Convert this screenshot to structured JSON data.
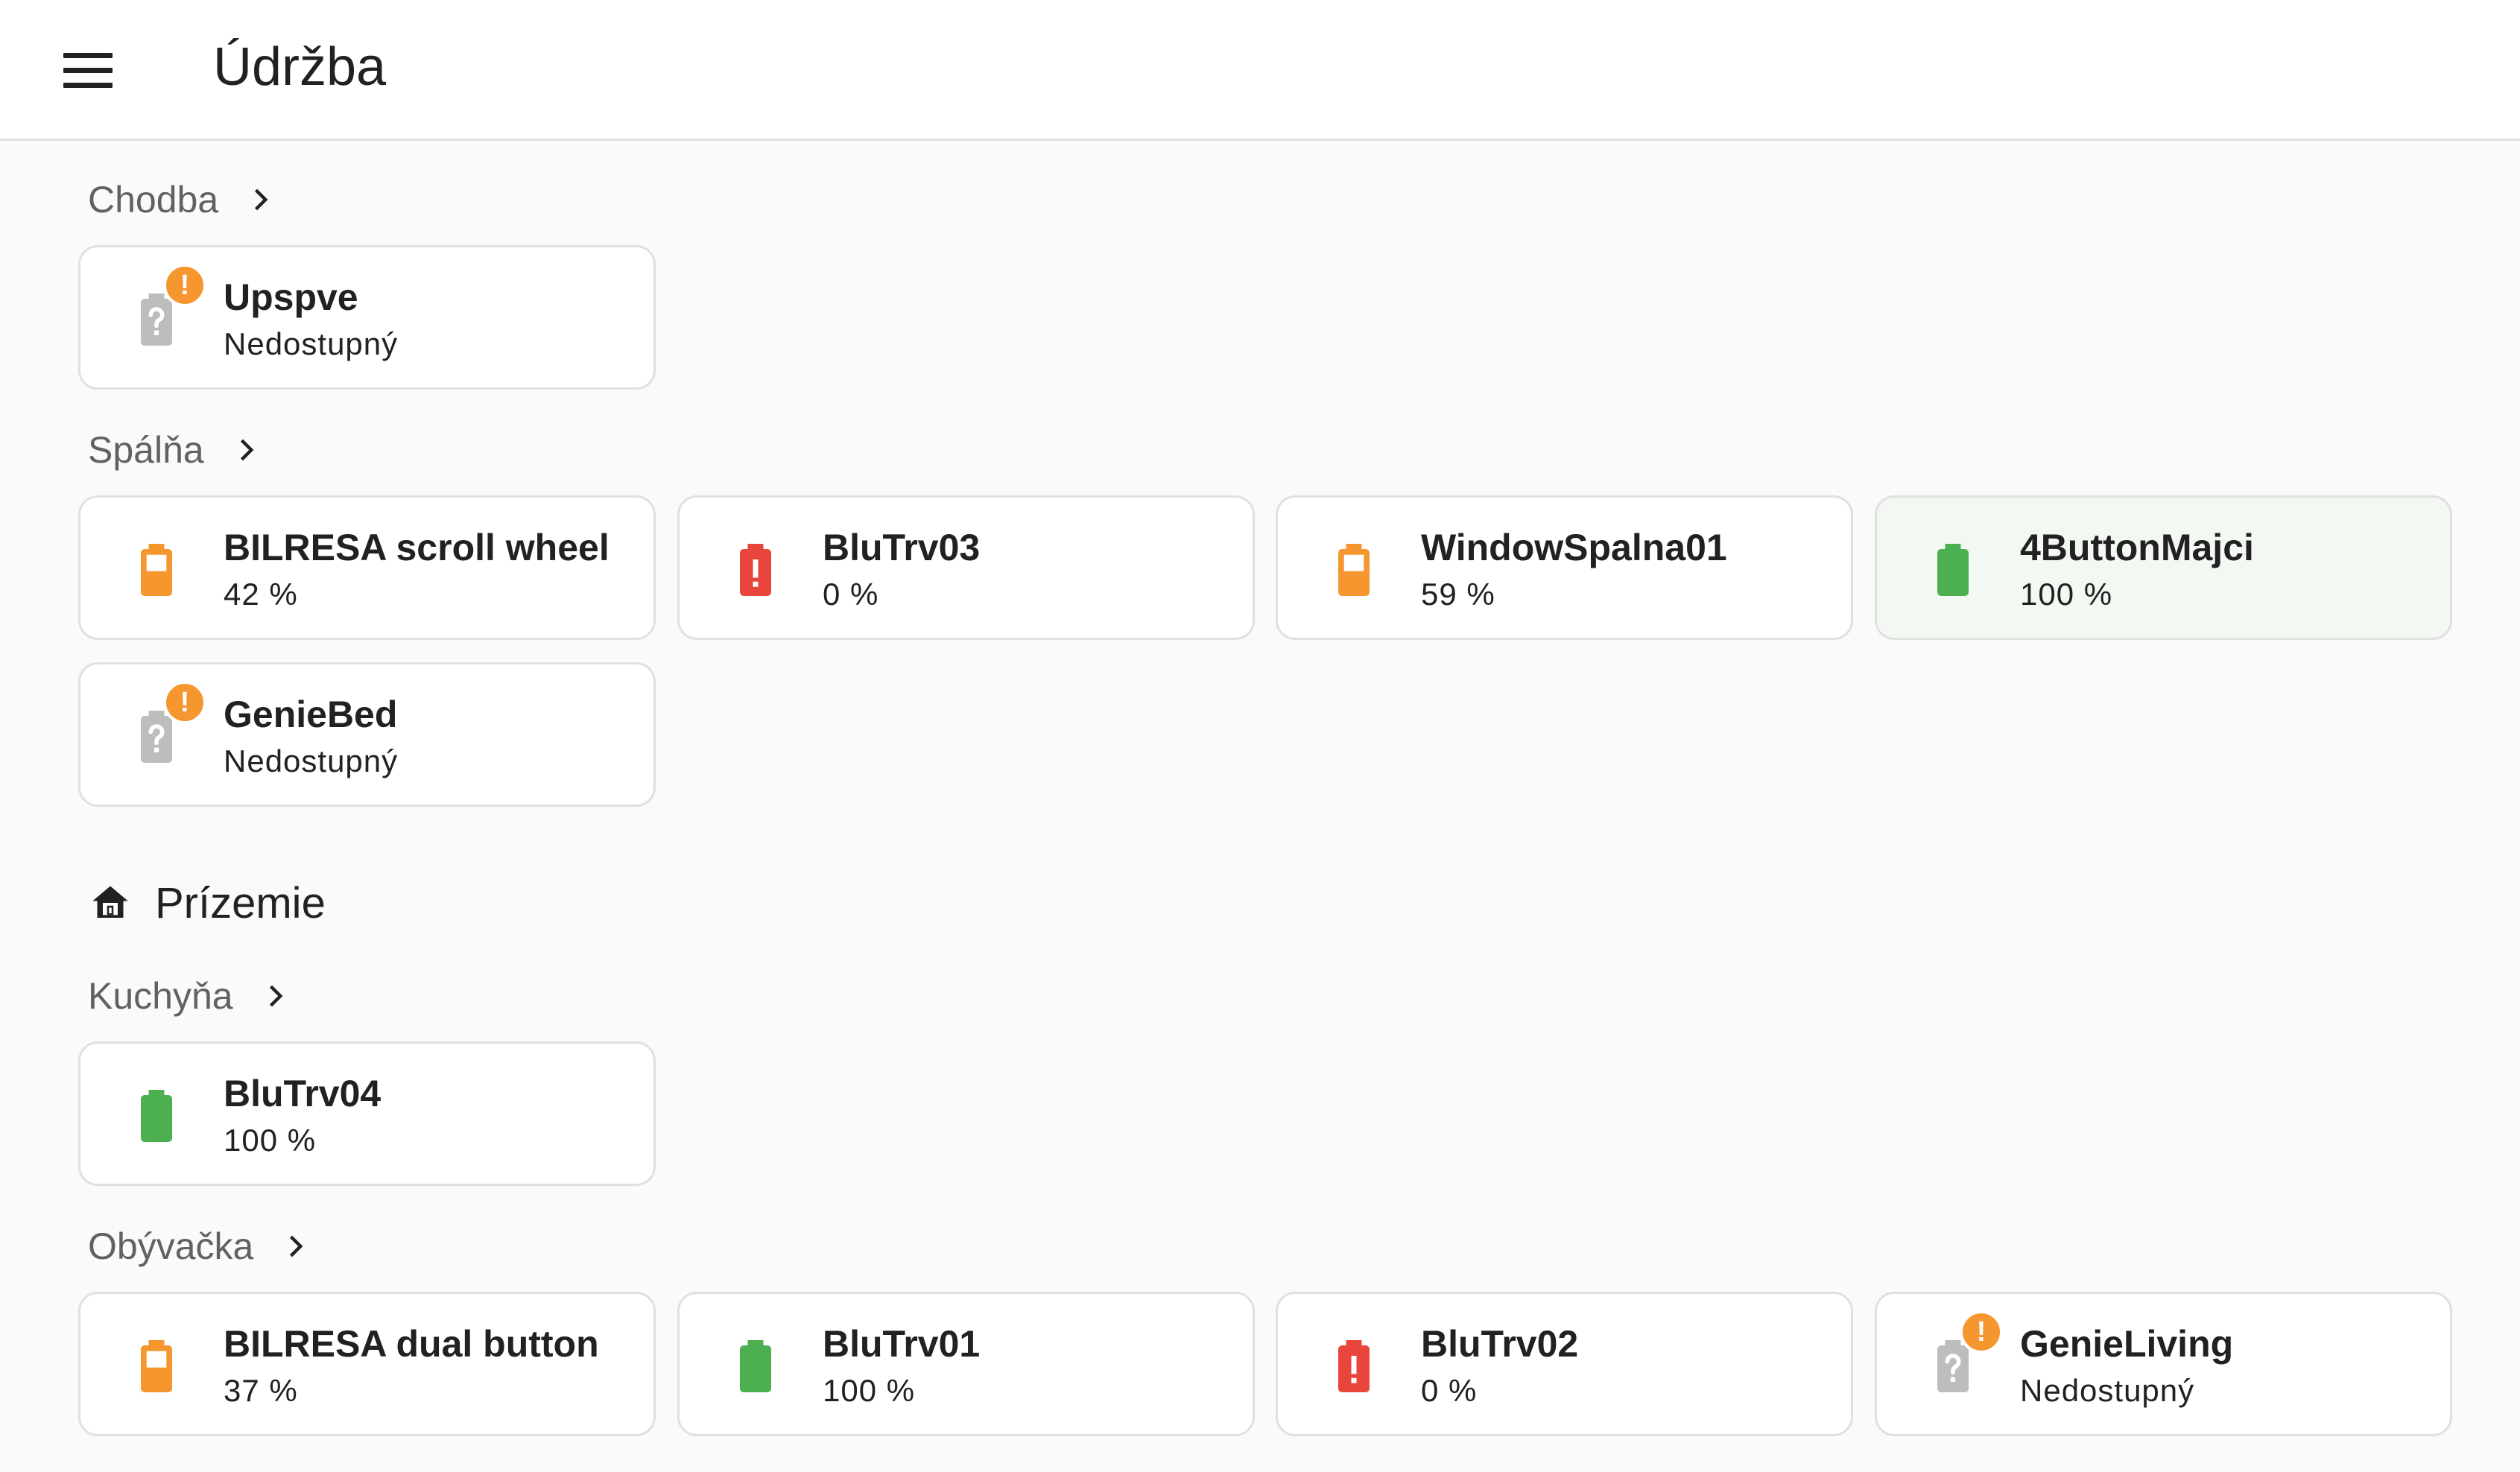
{
  "header": {
    "title": "Údržba"
  },
  "colors": {
    "orange": "#f5962e",
    "red": "#e8453c",
    "green": "#4caf50",
    "unknown": "#bdbdbd"
  },
  "areas": {
    "chodba": {
      "name": "Chodba",
      "devices": [
        {
          "name": "Upspve",
          "state": "Nedostupný",
          "battery_icon": "battery-unknown-icon",
          "warning": true
        }
      ]
    },
    "spalna": {
      "name": "Spálňa",
      "devices": [
        {
          "name": "BILRESA scroll wheel",
          "state": "42 %",
          "battery_icon": "battery-medium-icon",
          "level": 42
        },
        {
          "name": "BluTrv03",
          "state": "0 %",
          "battery_icon": "battery-alert-icon",
          "level": 0
        },
        {
          "name": "WindowSpalna01",
          "state": "59 %",
          "battery_icon": "battery-medium-icon",
          "level": 59
        },
        {
          "name": "4ButtonMajci",
          "state": "100 %",
          "battery_icon": "battery-full-icon",
          "level": 100
        },
        {
          "name": "GenieBed",
          "state": "Nedostupný",
          "battery_icon": "battery-unknown-icon",
          "warning": true
        }
      ]
    },
    "floor": {
      "name": "Prízemie",
      "icon": "home-floor-icon"
    },
    "kuchyna": {
      "name": "Kuchyňa",
      "devices": [
        {
          "name": "BluTrv04",
          "state": "100 %",
          "battery_icon": "battery-full-icon",
          "level": 100
        }
      ]
    },
    "obyvacka": {
      "name": "Obývačka",
      "devices": [
        {
          "name": "BILRESA dual button",
          "state": "37 %",
          "battery_icon": "battery-medium-icon",
          "level": 37
        },
        {
          "name": "BluTrv01",
          "state": "100 %",
          "battery_icon": "battery-full-icon",
          "level": 100
        },
        {
          "name": "BluTrv02",
          "state": "0 %",
          "battery_icon": "battery-alert-icon",
          "level": 0
        },
        {
          "name": "GenieLiving",
          "state": "Nedostupný",
          "battery_icon": "battery-unknown-icon",
          "warning": true
        }
      ]
    }
  }
}
